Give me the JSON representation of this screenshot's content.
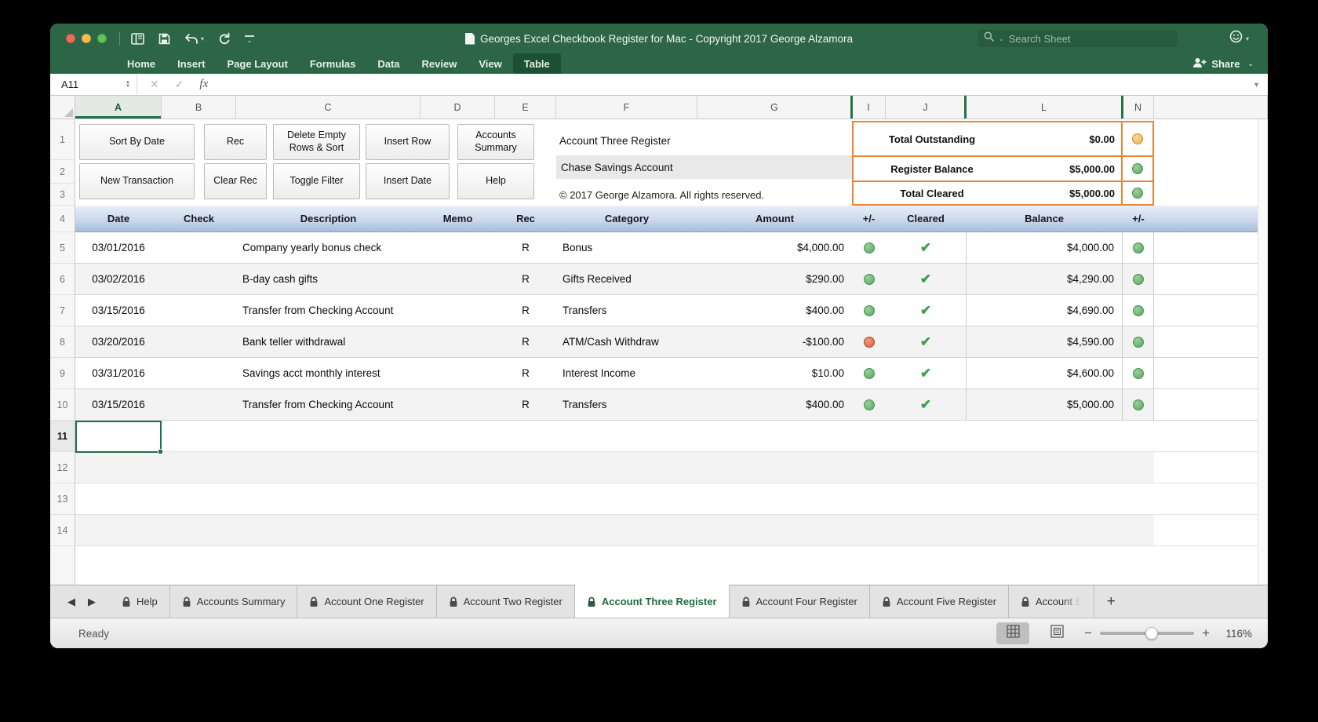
{
  "titlebar": {
    "title": "Georges Excel Checkbook Register for Mac - Copyright 2017 George Alzamora",
    "search_placeholder": "Search Sheet"
  },
  "ribbon": {
    "tabs": [
      "Home",
      "Insert",
      "Page Layout",
      "Formulas",
      "Data",
      "Review",
      "View",
      "Table"
    ],
    "active_tab": "Table",
    "share_label": "Share"
  },
  "formula_bar": {
    "name_box": "A11",
    "fx_label": "fx"
  },
  "grid": {
    "columns": [
      "A",
      "B",
      "C",
      "D",
      "E",
      "F",
      "G",
      "I",
      "J",
      "L",
      "N"
    ],
    "selected_column": "A",
    "row_numbers": [
      "1",
      "2",
      "3",
      "4",
      "5",
      "6",
      "7",
      "8",
      "9",
      "10",
      "11",
      "12",
      "13",
      "14"
    ],
    "selected_cell": "A11"
  },
  "action_buttons": {
    "row1": [
      "Sort By Date",
      "Rec",
      "Delete Empty Rows & Sort",
      "Insert Row",
      "Accounts Summary"
    ],
    "row2": [
      "New Transaction",
      "Clear Rec",
      "Toggle Filter",
      "Insert Date",
      "Help"
    ]
  },
  "account_info": {
    "register_title": "Account Three Register",
    "account_name": "Chase Savings Account",
    "copyright": "© 2017 George Alzamora.  All rights reserved."
  },
  "totals": [
    {
      "label": "Total Outstanding",
      "value": "$0.00",
      "status": "orange"
    },
    {
      "label": "Register Balance",
      "value": "$5,000.00",
      "status": "green"
    },
    {
      "label": "Total Cleared",
      "value": "$5,000.00",
      "status": "green"
    }
  ],
  "table": {
    "headers": [
      "Date",
      "Check",
      "Description",
      "Memo",
      "Rec",
      "Category",
      "Amount",
      "+/-",
      "Cleared",
      "Balance",
      "+/-"
    ],
    "rows": [
      {
        "date": "03/01/2016",
        "check": "",
        "description": "Company yearly bonus check",
        "memo": "",
        "rec": "R",
        "category": "Bonus",
        "amount": "$4,000.00",
        "amount_status": "green",
        "cleared": "✔",
        "balance": "$4,000.00",
        "balance_status": "green"
      },
      {
        "date": "03/02/2016",
        "check": "",
        "description": "B-day cash gifts",
        "memo": "",
        "rec": "R",
        "category": "Gifts Received",
        "amount": "$290.00",
        "amount_status": "green",
        "cleared": "✔",
        "balance": "$4,290.00",
        "balance_status": "green"
      },
      {
        "date": "03/15/2016",
        "check": "",
        "description": "Transfer from Checking Account",
        "memo": "",
        "rec": "R",
        "category": "Transfers",
        "amount": "$400.00",
        "amount_status": "green",
        "cleared": "✔",
        "balance": "$4,690.00",
        "balance_status": "green"
      },
      {
        "date": "03/20/2016",
        "check": "",
        "description": "Bank teller withdrawal",
        "memo": "",
        "rec": "R",
        "category": "ATM/Cash Withdraw",
        "amount": "-$100.00",
        "amount_status": "red",
        "cleared": "✔",
        "balance": "$4,590.00",
        "balance_status": "green"
      },
      {
        "date": "03/31/2016",
        "check": "",
        "description": "Savings acct monthly interest",
        "memo": "",
        "rec": "R",
        "category": "Interest Income",
        "amount": "$10.00",
        "amount_status": "green",
        "cleared": "✔",
        "balance": "$4,600.00",
        "balance_status": "green"
      },
      {
        "date": "03/15/2016",
        "check": "",
        "description": "Transfer from Checking Account",
        "memo": "",
        "rec": "R",
        "category": "Transfers",
        "amount": "$400.00",
        "amount_status": "green",
        "cleared": "✔",
        "balance": "$5,000.00",
        "balance_status": "green"
      }
    ]
  },
  "sheet_tabs": {
    "tabs": [
      {
        "label": "Help"
      },
      {
        "label": "Accounts Summary"
      },
      {
        "label": "Account One Register"
      },
      {
        "label": "Account Two Register"
      },
      {
        "label": "Account Three Register"
      },
      {
        "label": "Account Four Register"
      },
      {
        "label": "Account Five Register"
      },
      {
        "label": "Account S"
      }
    ],
    "active": "Account Three Register"
  },
  "status_bar": {
    "status": "Ready",
    "zoom": "116%"
  },
  "colors": {
    "titlebar_green": "#2c6647",
    "accent_green": "#217346",
    "status_green": "#6cb56c",
    "status_red": "#d9603f",
    "status_orange": "#efac45",
    "totals_border_orange": "#ea8438"
  },
  "icons": {
    "check": "✔",
    "undo": "↶",
    "redo": "↻",
    "close": "✕",
    "confirm": "✓",
    "chevron_down": "⌄",
    "stepper_up": "▲",
    "stepper_down": "▼",
    "tab_prev": "◀",
    "tab_next": "▶",
    "add_sheet": "+",
    "zoom_out": "−",
    "zoom_in": "+"
  }
}
